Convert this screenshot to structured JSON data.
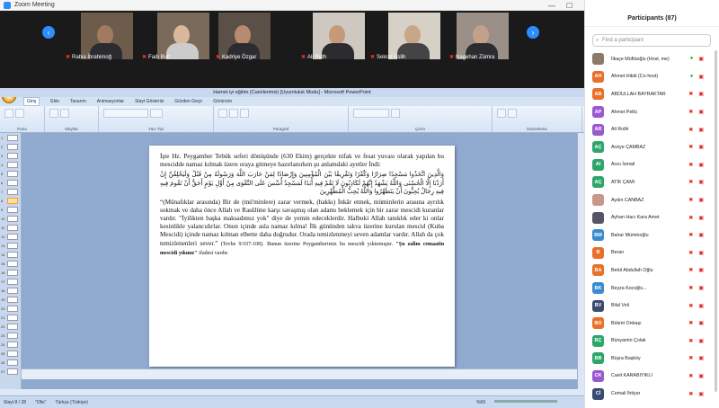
{
  "zoom": {
    "title": "Zoom Meeting"
  },
  "videos": [
    {
      "name": "Rabia İbrahimoğ"
    },
    {
      "name": "Fadı Bulf"
    },
    {
      "name": "Kadriye Özgar"
    },
    {
      "name": "Ali Rıdh"
    },
    {
      "name": "Sekrat Uslih"
    },
    {
      "name": "Nagehan Zümra"
    }
  ],
  "ppt": {
    "window_title": "Hamet iyi eğitim (Camilerimiz) [Uyumluluk Modu] - Microsoft PowerPoint",
    "tabs": [
      "Giriş",
      "Ekle",
      "Tasarım",
      "Animasyonlar",
      "Slayt Gösterisi",
      "Gözden Geçir",
      "Görünüm"
    ],
    "groups": [
      "Pano",
      "Slaytlar",
      "Yazı Tipi",
      "Paragraf",
      "Çizim",
      "Düzenleme"
    ],
    "status_slide": "Slayt 8 / 28",
    "status_theme": "\"Ofis\"",
    "status_lang": "Türkçe (Türkiye)",
    "zoom_pct": "%69"
  },
  "slide": {
    "p1": "İşte Hz. Peygamber Tebük seferi dönüşünde (630 Ekim) gerçekte nifak ve fesat yuvası olarak yapılan bu mescidde namaz kılmak üzere oraya gitmeye hazırlanırken şu anlamdaki ayetler İndi:",
    "arabic": "وَالَّذِينَ اتَّخَذُوا مَسْجِدًا ضِرَارًا وَكُفْرًا وَتَفْرِيقًا بَيْنَ الْمُؤْمِنِينَ وَإِرْصَادًا لِمَنْ حَارَبَ اللَّهَ وَرَسُولَهُ مِنْ قَبْلُ وَلَيَحْلِفُنَّ إِنْ أَرَدْنَا إِلَّا الْحُسْنَى وَاللَّهُ يَشْهَدُ إِنَّهُمْ لَكَاذِبُونَ لَا تَقُمْ فِيهِ أَبَدًا لَمَسْجِدٌ أُسِّسَ عَلَى التَّقْوَى مِنْ أَوَّلِ يَوْمٍ أَحَقُّ أَنْ تَقُومَ فِيهِ فِيهِ رِجَالٌ يُحِبُّونَ أَنْ يَتَطَهَّرُوا وَاللَّهُ يُحِبُّ الْمُطَّهِّرِينَ",
    "p2": "“(Münafıklar arasında) Bir de (mü'minlere) zarar vermek, (hakkı) İnkâr etmek, müminlerin arasına ayrılık sokmak ve daha önce Allah ve Rasûlüne karşı savaşmış olan adamı beklemek için bir zarar mescidi kuranlar vardır. \"İyilikten başka maksadımız yok\" diye de yemin edeceklerdir. Halbuki Allah tanıklık eder ki onlar kesinlikle yalancıdırlar. Onun içinde asla namaz kılma! İlk gününden takva üzerine kurulan mescid (Kuba Mescidi) içinde namaz kılman elbette daha doğrudur. Orada temizlenmeyi seven adamlar vardır. Allah da çok temizlenenleri sever.”",
    "ref": "(Tevbe 9/107-108).",
    "p3a": "Bunun üzerine Peygamberimiz bu mescidi yıktırmıştır.",
    "p3b": "\"Şu zalim cemaatin mescidi yıkınız\"",
    "p3c": "ifadesi vardır."
  },
  "participants": {
    "header": "Participants (87)",
    "search_placeholder": "Find a participant",
    "list": [
      {
        "initials": "",
        "name": "İlkaçe Müftüoğlu (Host, me)",
        "color": "#8a7a6a",
        "mic": "on"
      },
      {
        "initials": "AH",
        "name": "Ahmet Hikâl (Co-host)",
        "color": "#e8702a",
        "mic": "on"
      },
      {
        "initials": "AB",
        "name": "ABDULLAH BAYRAKTAR",
        "color": "#e8702a",
        "mic": "off"
      },
      {
        "initials": "AP",
        "name": "Ahmet Peltü",
        "color": "#9b59d0",
        "mic": "off"
      },
      {
        "initials": "AR",
        "name": "Ali RıdH",
        "color": "#9b59d0",
        "mic": "off"
      },
      {
        "initials": "AÇ",
        "name": "Arziye ÇAMBAZ",
        "color": "#2ea56b",
        "mic": "off"
      },
      {
        "initials": "AI",
        "name": "Arzu İsmail",
        "color": "#2ea56b",
        "mic": "off"
      },
      {
        "initials": "AÇ",
        "name": "ATİK ÇAMI",
        "color": "#2ea56b",
        "mic": "off"
      },
      {
        "initials": "",
        "name": "Aydın CANBAZ",
        "color": "#c9968a",
        "mic": "off"
      },
      {
        "initials": "",
        "name": "Ayhan Hacı Kara Amet",
        "color": "#556",
        "mic": "off"
      },
      {
        "initials": "BM",
        "name": "Bahar Müminoğlu",
        "color": "#3a8bd0",
        "mic": "off"
      },
      {
        "initials": "B",
        "name": "Beran",
        "color": "#e8702a",
        "mic": "off"
      },
      {
        "initials": "BA",
        "name": "Betül Abdullah Oğlu",
        "color": "#e8702a",
        "mic": "off"
      },
      {
        "initials": "BK",
        "name": "Beyza Kocoğlu...",
        "color": "#3a8bd0",
        "mic": "off"
      },
      {
        "initials": "BV",
        "name": "Bilal Veli",
        "color": "#3a4a70",
        "mic": "off"
      },
      {
        "initials": "BO",
        "name": "Bülent Onbaşı",
        "color": "#e8702a",
        "mic": "off"
      },
      {
        "initials": "BÇ",
        "name": "Bünyamin Çolak",
        "color": "#2ea56b",
        "mic": "off"
      },
      {
        "initials": "BB",
        "name": "Büşra Başköy",
        "color": "#2ea56b",
        "mic": "off"
      },
      {
        "initials": "CK",
        "name": "Cavit KARABIYIKLI",
        "color": "#9b59d0",
        "mic": "off"
      },
      {
        "initials": "Cİ",
        "name": "Cemali İhtiyar",
        "color": "#3a4a70",
        "mic": "off"
      }
    ]
  }
}
